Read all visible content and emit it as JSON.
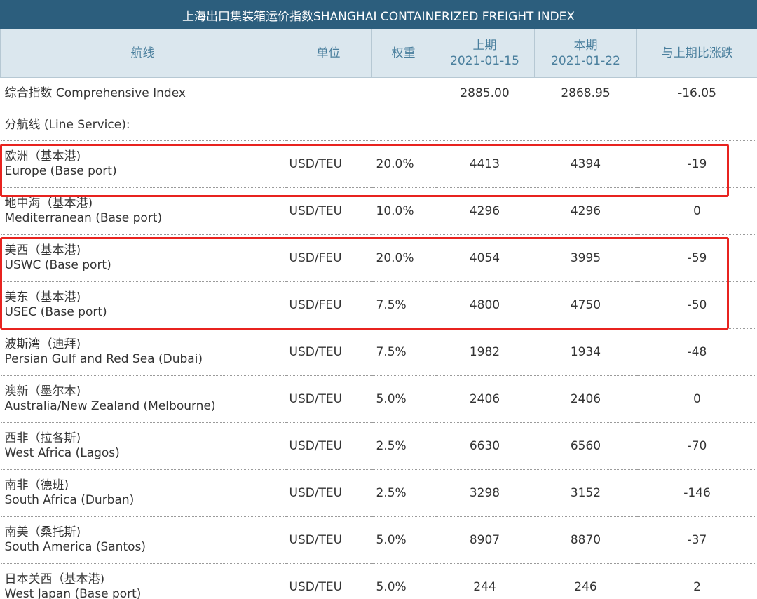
{
  "title": "上海出口集装箱运价指数SHANGHAI CONTAINERIZED FREIGHT INDEX",
  "headers": {
    "route": "航线",
    "unit": "单位",
    "weight": "权重",
    "prev_label": "上期",
    "prev_date": "2021-01-15",
    "curr_label": "本期",
    "curr_date": "2021-01-22",
    "change": "与上期比涨跌"
  },
  "comprehensive": {
    "label": "综合指数 Comprehensive Index",
    "prev": "2885.00",
    "curr": "2868.95",
    "change": "-16.05"
  },
  "line_service_label": "分航线 (Line Service):",
  "rows": [
    {
      "cn": "欧洲（基本港)",
      "en": "Europe (Base port)",
      "unit": "USD/TEU",
      "weight": "20.0%",
      "prev": "4413",
      "curr": "4394",
      "change": "-19"
    },
    {
      "cn": "地中海（基本港)",
      "en": "Mediterranean (Base port)",
      "unit": "USD/TEU",
      "weight": "10.0%",
      "prev": "4296",
      "curr": "4296",
      "change": "0"
    },
    {
      "cn": "美西（基本港)",
      "en": "USWC (Base port)",
      "unit": "USD/FEU",
      "weight": "20.0%",
      "prev": "4054",
      "curr": "3995",
      "change": "-59"
    },
    {
      "cn": "美东（基本港)",
      "en": "USEC (Base port)",
      "unit": "USD/FEU",
      "weight": "7.5%",
      "prev": "4800",
      "curr": "4750",
      "change": "-50"
    },
    {
      "cn": "波斯湾（迪拜)",
      "en": "Persian Gulf and Red Sea (Dubai)",
      "unit": "USD/TEU",
      "weight": "7.5%",
      "prev": "1982",
      "curr": "1934",
      "change": "-48"
    },
    {
      "cn": "澳新（墨尔本)",
      "en": "Australia/New Zealand (Melbourne)",
      "unit": "USD/TEU",
      "weight": "5.0%",
      "prev": "2406",
      "curr": "2406",
      "change": "0"
    },
    {
      "cn": "西非（拉各斯)",
      "en": "West Africa (Lagos)",
      "unit": "USD/TEU",
      "weight": "2.5%",
      "prev": "6630",
      "curr": "6560",
      "change": "-70"
    },
    {
      "cn": "南非（德班)",
      "en": "South Africa (Durban)",
      "unit": "USD/TEU",
      "weight": "2.5%",
      "prev": "3298",
      "curr": "3152",
      "change": "-146"
    },
    {
      "cn": "南美（桑托斯)",
      "en": "South America (Santos)",
      "unit": "USD/TEU",
      "weight": "5.0%",
      "prev": "8907",
      "curr": "8870",
      "change": "-37"
    },
    {
      "cn": "日本关西（基本港)",
      "en": "West Japan (Base port)",
      "unit": "USD/TEU",
      "weight": "5.0%",
      "prev": "244",
      "curr": "246",
      "change": "2"
    }
  ],
  "highlight_color": "#e8231f",
  "header_color": "#2c5e7d"
}
